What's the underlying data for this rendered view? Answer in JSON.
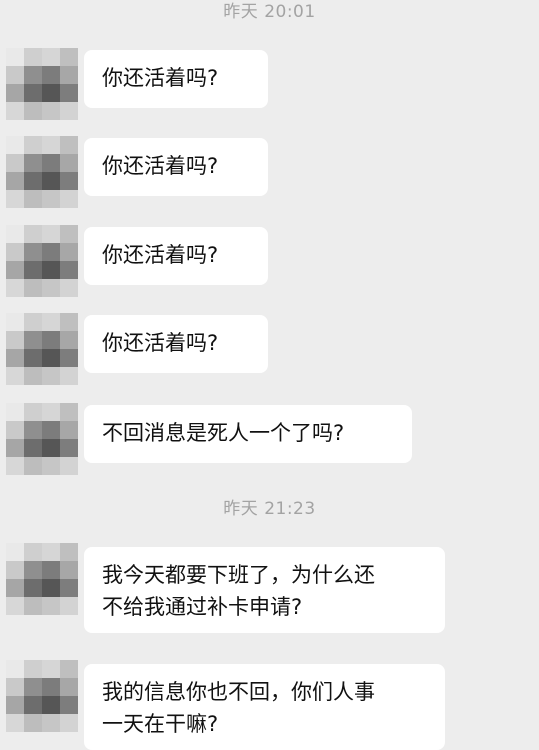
{
  "chat": {
    "timestamps": [
      "昨天  20:01",
      "昨天  21:23"
    ],
    "messages": [
      {
        "text": "你还活着吗?"
      },
      {
        "text": "你还活着吗?"
      },
      {
        "text": "你还活着吗?"
      },
      {
        "text": "你还活着吗?"
      },
      {
        "text": "不回消息是死人一个了吗?"
      },
      {
        "text": "我今天都要下班了，为什么还\n不给我通过补卡申请?"
      },
      {
        "text": "我的信息你也不回，你们人事\n一天在干嘛?"
      }
    ]
  },
  "avatar": {
    "icon": "pixelated-avatar-icon",
    "colors": [
      "#e9e9e9",
      "#cfcfcf",
      "#d6d6d6",
      "#bfbfbf",
      "#c9c9c9",
      "#8f8f8f",
      "#7c7c7c",
      "#a7a7a7",
      "#a6a6a6",
      "#6d6d6d",
      "#565656",
      "#7d7d7d",
      "#d7d7d7",
      "#bdbdbd",
      "#c6c6c6",
      "#d3d3d3"
    ]
  },
  "colors": {
    "background": "#ededed",
    "bubble": "#ffffff",
    "timestamp_text": "#a3a3a3",
    "message_text": "#111111"
  }
}
